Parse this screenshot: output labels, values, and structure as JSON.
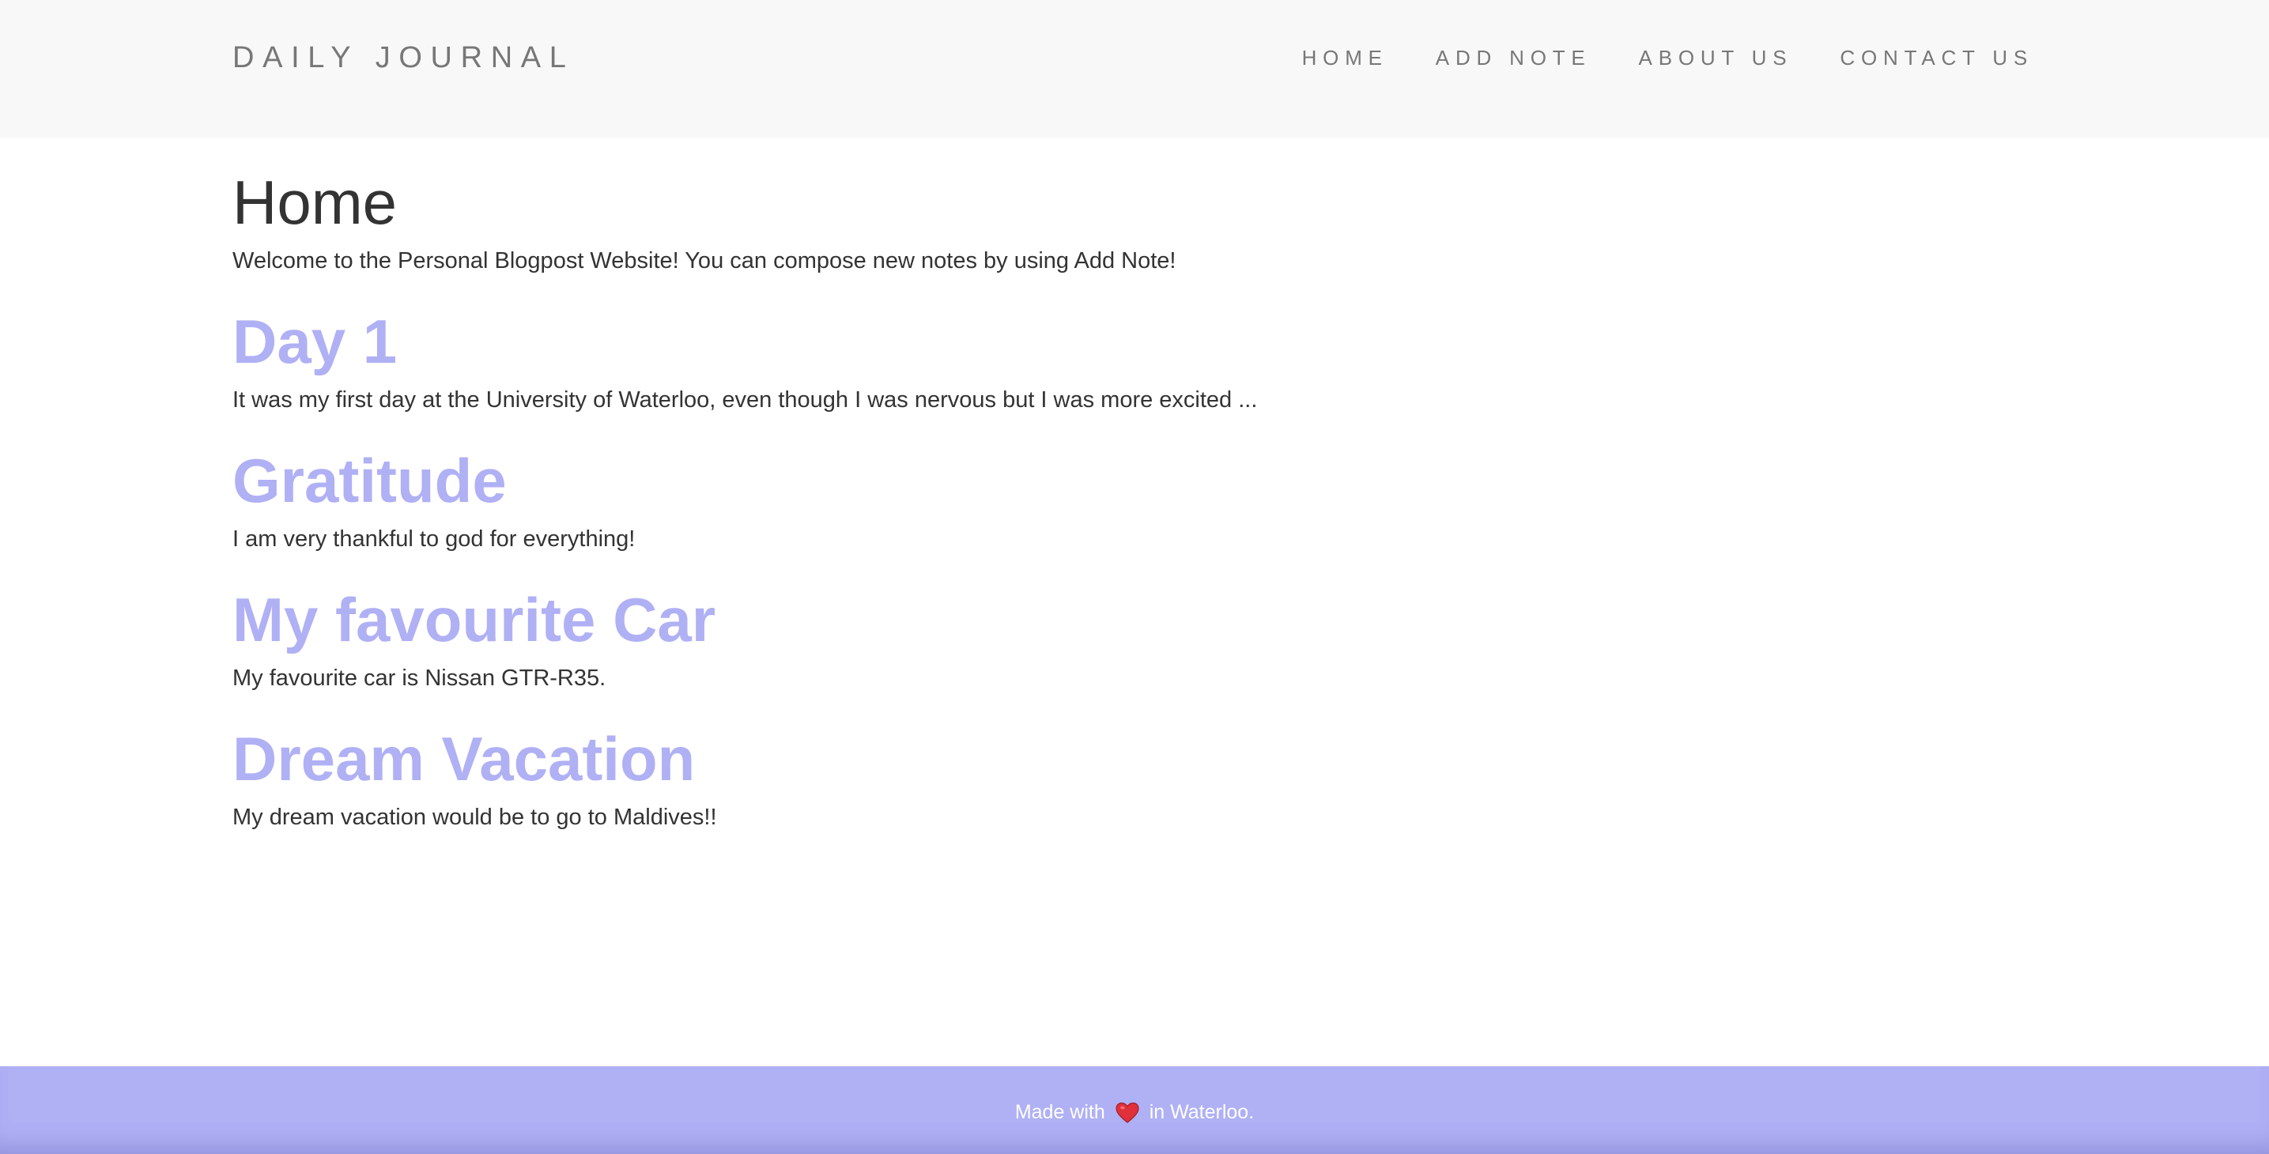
{
  "header": {
    "brand": "DAILY JOURNAL",
    "nav": [
      {
        "label": "HOME"
      },
      {
        "label": "ADD NOTE"
      },
      {
        "label": "ABOUT US"
      },
      {
        "label": "CONTACT US"
      }
    ]
  },
  "main": {
    "title": "Home",
    "intro": "Welcome to the Personal Blogpost Website! You can compose new notes by using Add Note!",
    "posts": [
      {
        "title": "Day 1",
        "body": "It was my first day at the University of Waterloo, even though I was nervous but I was more excited ..."
      },
      {
        "title": "Gratitude",
        "body": "I am very thankful to god for everything!"
      },
      {
        "title": "My favourite Car",
        "body": "My favourite car is Nissan GTR-R35."
      },
      {
        "title": "Dream Vacation",
        "body": "My dream vacation would be to go to Maldives!!"
      }
    ]
  },
  "footer": {
    "text_before": "Made with",
    "icon": "heart-icon",
    "text_after": "in Waterloo."
  },
  "colors": {
    "navbar_bg": "#f8f8f8",
    "accent": "#b0b0f5",
    "text": "#333333",
    "nav_text": "#777777",
    "heart": "#e0303a"
  }
}
